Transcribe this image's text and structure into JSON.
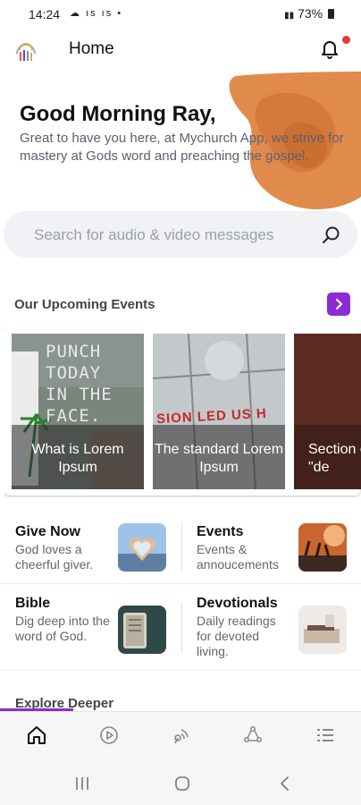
{
  "status_bar": {
    "time": "14:24",
    "left_indicators": "☁ ıs ıs •",
    "right_text": "73%"
  },
  "header": {
    "title": "Home",
    "has_notification": true
  },
  "hero": {
    "greeting": "Good Morning Ray,",
    "message": "Great to have you here, at Mychurch App, we strive for mastery at Gods word and preaching the gospel."
  },
  "search": {
    "placeholder": "Search for audio & video messages"
  },
  "upcoming_events": {
    "title": "Our Upcoming Events",
    "cards": [
      {
        "caption": "What is Lorem Ipsum",
        "image_text": "PUNCH\nTODAY\nIN THE\nFACE."
      },
      {
        "caption": "The standard Lorem Ipsum",
        "image_text": "SION LED US H"
      },
      {
        "caption": "Section of \"de"
      }
    ]
  },
  "quick_links": [
    {
      "title": "Give Now",
      "subtitle": "God loves a cheerful giver."
    },
    {
      "title": "Events",
      "subtitle": "Events & annoucements"
    },
    {
      "title": "Bible",
      "subtitle": "Dig deep into the word of God."
    },
    {
      "title": "Devotionals",
      "subtitle": "Daily readings for devoted living."
    }
  ],
  "explore": {
    "title": "Explore Deeper"
  },
  "bottom_tabs": [
    "home-icon",
    "play-icon",
    "podcast-icon",
    "community-icon",
    "menu-list-icon"
  ],
  "colors": {
    "accent": "#8c2bd6",
    "hero_shape": "#e08a4c",
    "notification_dot": "#e53935"
  }
}
